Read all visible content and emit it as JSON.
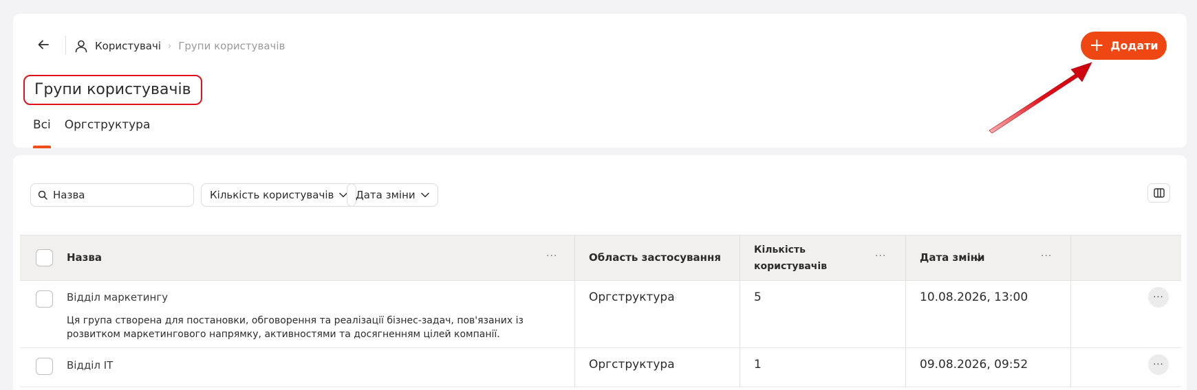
{
  "breadcrumb": {
    "root": "Користувачі",
    "separator": "›",
    "current": "Групи користувачів"
  },
  "page": {
    "title": "Групи користувачів"
  },
  "tabs": [
    {
      "label": "Всі",
      "active": true
    },
    {
      "label": "Оргструктура",
      "active": false
    }
  ],
  "actions": {
    "add_label": "Додати",
    "add_icon": "plus-icon"
  },
  "filters": {
    "search_placeholder": "Назва",
    "users_count_label": "Кількість користувачів",
    "date_label": "Дата зміни"
  },
  "table": {
    "columns": {
      "name": "Назва",
      "scope": "Область застосування",
      "users_line1": "Кількість",
      "users_line2": "користувачів",
      "date": "Дата зміни",
      "more": "···"
    },
    "rows": [
      {
        "name": "Відділ маркетингу",
        "description": "Ця група створена для постановки, обговорення та реалізації бізнес-задач, пов'язаних із розвитком маркетингового напрямку, активностями та досягненням цілей компанії.",
        "scope": "Оргструктура",
        "users": "5",
        "date": "10.08.2026, 13:00",
        "more": "···"
      },
      {
        "name": "Відділ IT",
        "description": "",
        "scope": "Оргструктура",
        "users": "1",
        "date": "09.08.2026, 09:52",
        "more": "···"
      }
    ]
  },
  "colors": {
    "accent": "#ee4714",
    "highlight_border": "#e0101c",
    "annotation_arrow": "#e0101c"
  }
}
